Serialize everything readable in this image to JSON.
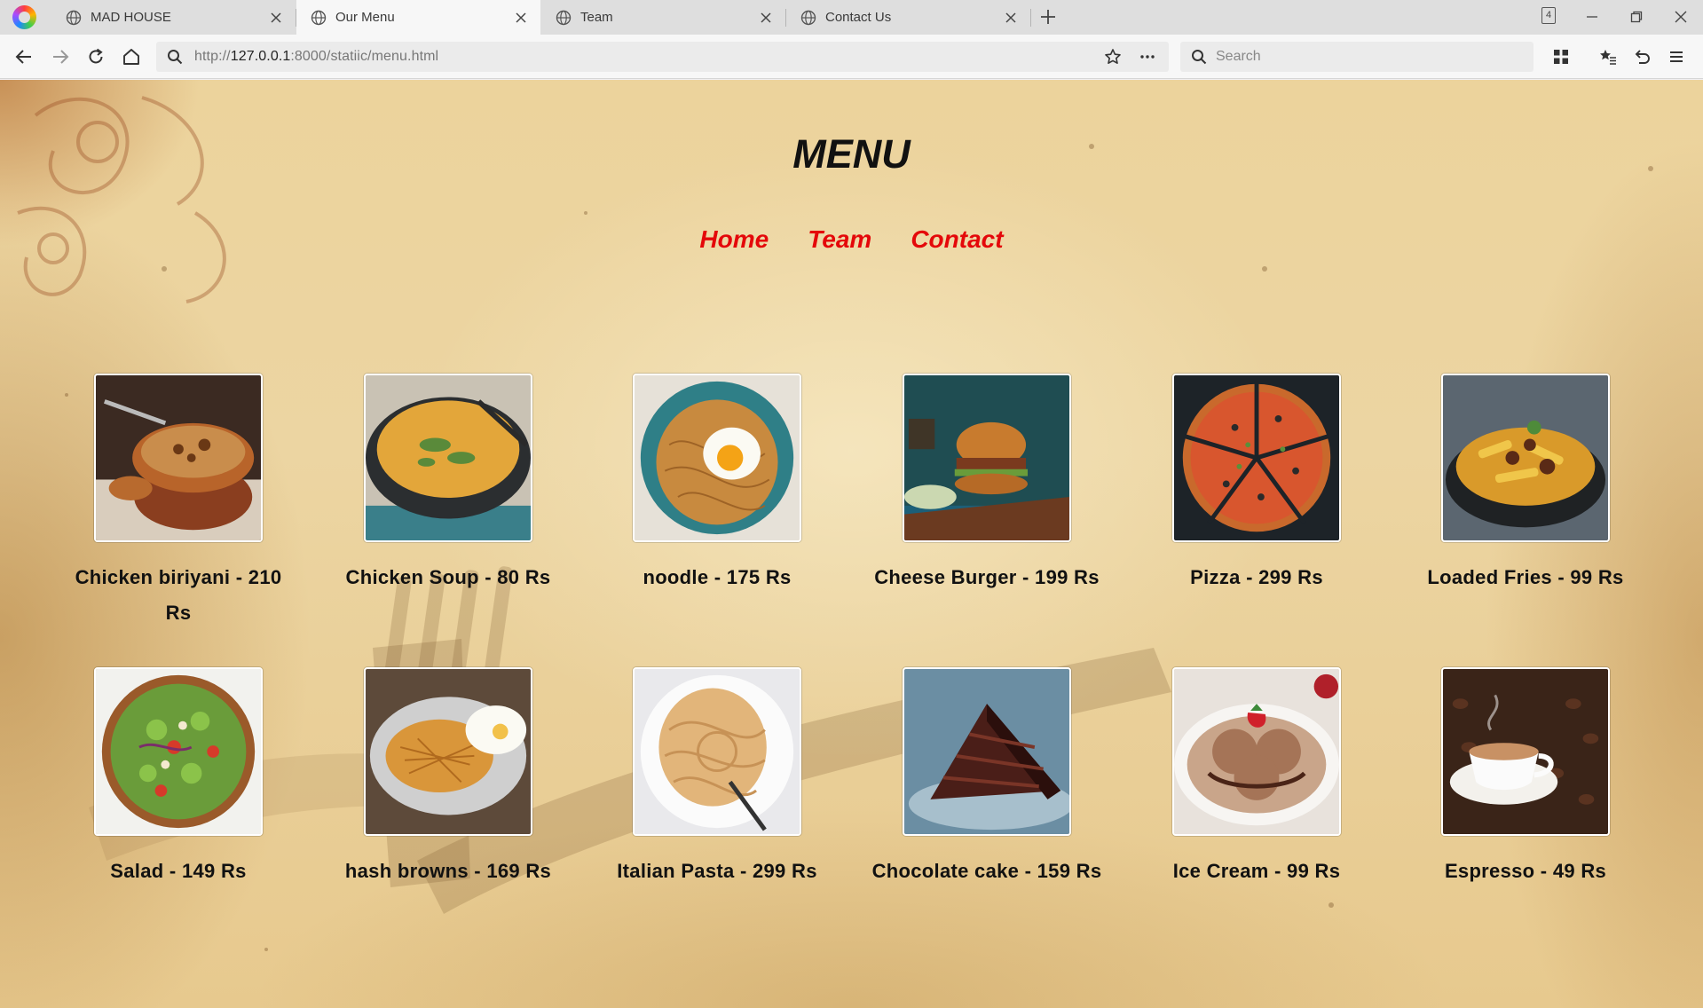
{
  "browser": {
    "tabs": [
      {
        "title": "MAD HOUSE"
      },
      {
        "title": "Our Menu"
      },
      {
        "title": "Team"
      },
      {
        "title": "Contact Us"
      }
    ],
    "tab_count": "4",
    "url_prefix": "http://",
    "url_host": "127.0.0.1",
    "url_rest": ":8000/statiic/menu.html",
    "search_placeholder": "Search"
  },
  "page": {
    "title": "MENU",
    "nav": [
      "Home",
      "Team",
      "Contact"
    ],
    "items": [
      {
        "label": "Chicken biriyani - 210 Rs",
        "image": "biriyani-photo"
      },
      {
        "label": "Chicken Soup - 80 Rs",
        "image": "soup-photo"
      },
      {
        "label": "noodle - 175 Rs",
        "image": "noodle-photo"
      },
      {
        "label": "Cheese Burger - 199 Rs",
        "image": "burger-photo"
      },
      {
        "label": "Pizza - 299 Rs",
        "image": "pizza-photo"
      },
      {
        "label": "Loaded Fries - 99 Rs",
        "image": "fries-photo"
      },
      {
        "label": "Salad - 149 Rs",
        "image": "salad-photo"
      },
      {
        "label": "hash browns - 169 Rs",
        "image": "hash-browns-photo"
      },
      {
        "label": "Italian Pasta - 299 Rs",
        "image": "pasta-photo"
      },
      {
        "label": "Chocolate cake - 159 Rs",
        "image": "cake-photo"
      },
      {
        "label": "Ice Cream - 99 Rs",
        "image": "ice-cream-photo"
      },
      {
        "label": "Espresso - 49 Rs",
        "image": "espresso-photo"
      }
    ]
  },
  "colors": {
    "nav_link": "#e4080a",
    "title": "#111111",
    "parchment": "#ecd39c"
  }
}
